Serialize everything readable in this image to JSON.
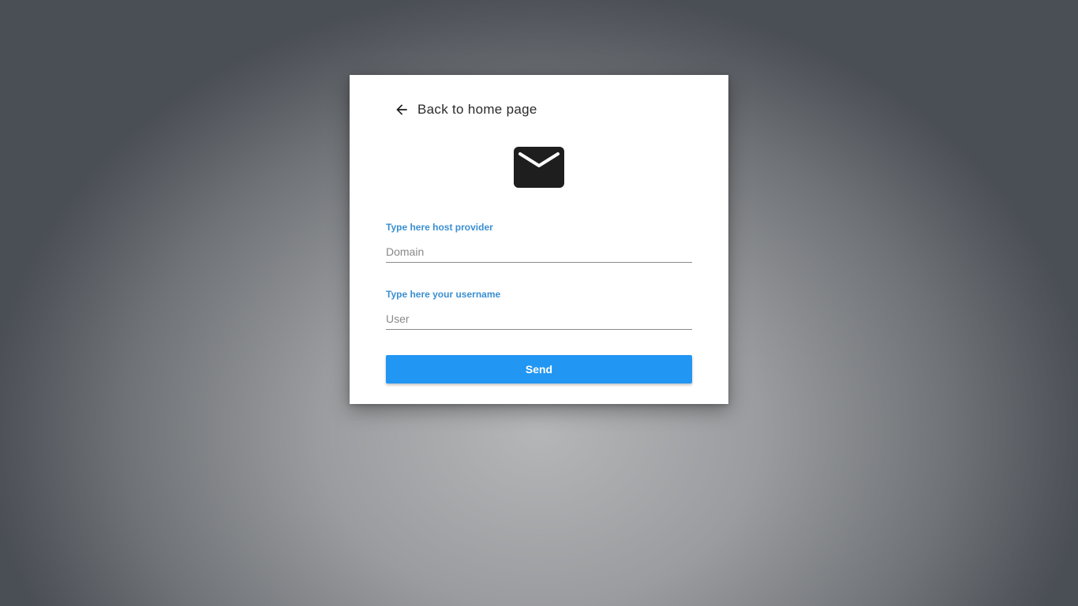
{
  "back_link": {
    "label": "Back to home page",
    "icon": "arrow-left-icon"
  },
  "header_icon": "mail-icon",
  "form": {
    "domain": {
      "label": "Type here host provider",
      "placeholder": "Domain",
      "value": ""
    },
    "user": {
      "label": "Type here your username",
      "placeholder": "User",
      "value": ""
    },
    "submit_label": "Send"
  },
  "colors": {
    "accent": "#2196f3",
    "label": "#3a8fd1",
    "card": "#ffffff"
  }
}
